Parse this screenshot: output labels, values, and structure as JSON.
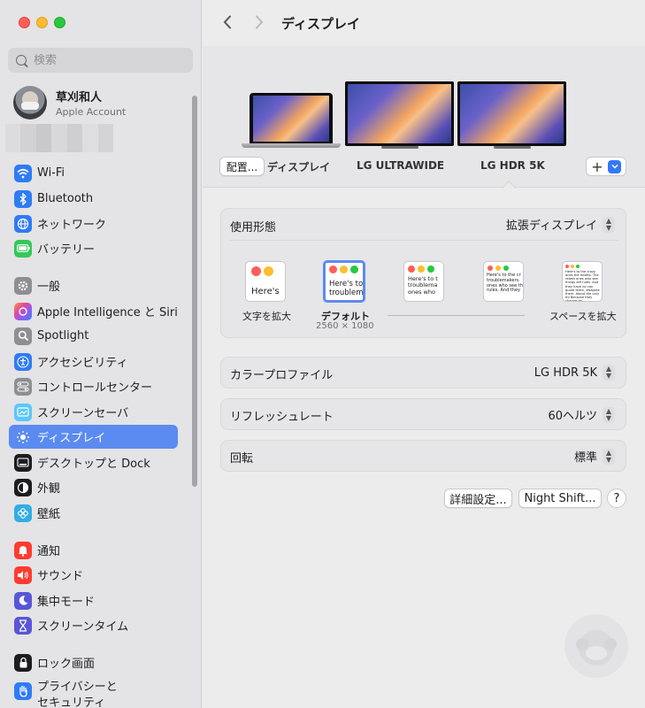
{
  "window": {
    "title": "ディスプレイ"
  },
  "search": {
    "placeholder": "検索"
  },
  "account": {
    "name": "草刈和人",
    "subtitle": "Apple Account"
  },
  "sidebar": {
    "items": [
      {
        "label": "Wi-Fi",
        "icon": "wifi-icon",
        "color": "#2f7bf5"
      },
      {
        "label": "Bluetooth",
        "icon": "bluetooth-icon",
        "color": "#2f7bf5"
      },
      {
        "label": "ネットワーク",
        "icon": "globe-icon",
        "color": "#2f7bf5"
      },
      {
        "label": "バッテリー",
        "icon": "battery-icon",
        "color": "#34c759"
      },
      {
        "label": "一般",
        "icon": "gear-icon",
        "color": "#8e8e93"
      },
      {
        "label": "Apple Intelligence と Siri",
        "icon": "siri-icon",
        "color": "#d65cf2"
      },
      {
        "label": "Spotlight",
        "icon": "magnifier-icon",
        "color": "#8e8e93"
      },
      {
        "label": "アクセシビリティ",
        "icon": "accessibility-icon",
        "color": "#2f7bf5"
      },
      {
        "label": "コントロールセンター",
        "icon": "toggles-icon",
        "color": "#8e8e93"
      },
      {
        "label": "スクリーンセーバ",
        "icon": "screensaver-icon",
        "color": "#5ac8fa"
      },
      {
        "label": "ディスプレイ",
        "icon": "sun-icon",
        "color": "#2f7bf5",
        "active": true
      },
      {
        "label": "デスクトップと Dock",
        "icon": "dock-icon",
        "color": "#1d1d1f"
      },
      {
        "label": "外観",
        "icon": "appearance-icon",
        "color": "#1d1d1f"
      },
      {
        "label": "壁紙",
        "icon": "wallpaper-icon",
        "color": "#32ade6"
      },
      {
        "label": "通知",
        "icon": "bell-icon",
        "color": "#ff3b30"
      },
      {
        "label": "サウンド",
        "icon": "speaker-icon",
        "color": "#ff3b30"
      },
      {
        "label": "集中モード",
        "icon": "moon-icon",
        "color": "#5856d6"
      },
      {
        "label": "スクリーンタイム",
        "icon": "hourglass-icon",
        "color": "#5856d6"
      },
      {
        "label": "ロック画面",
        "icon": "lock-icon",
        "color": "#1d1d1f"
      },
      {
        "label": "プライバシーと",
        "label2": "セキュリティ",
        "icon": "hand-icon",
        "color": "#2f7bf5"
      }
    ]
  },
  "arrange": {
    "arrange_button": "配置...",
    "displays": [
      {
        "label": "ディスプレイ"
      },
      {
        "label": "LG ULTRAWIDE"
      },
      {
        "label": "LG HDR 5K",
        "selected": true
      }
    ],
    "add_label": "+"
  },
  "usage": {
    "label": "使用形態",
    "value": "拡張ディスプレイ"
  },
  "resolution": {
    "options": [
      {
        "caption": "文字を拡大",
        "sample": "Here's"
      },
      {
        "caption": "デフォルト",
        "subcaption": "2560 × 1080",
        "sample": "Here's to troublem",
        "selected": true
      },
      {
        "caption": "",
        "sample": "Here's to t troublema ones who"
      },
      {
        "caption": "",
        "sample": "Here's to the cr troublemakers. ones who see th rules. And they"
      },
      {
        "caption": "スペースを拡大",
        "sample": "Here's to the crazy ones the misfits. The rebels ones who see things diff rules. And they have no can quote them, disagree them. About the only thi Because they change thi"
      }
    ]
  },
  "color_profile": {
    "label": "カラープロファイル",
    "value": "LG HDR 5K"
  },
  "refresh_rate": {
    "label": "リフレッシュレート",
    "value": "60ヘルツ"
  },
  "rotation": {
    "label": "回転",
    "value": "標準"
  },
  "buttons": {
    "advanced": "詳細設定...",
    "night_shift": "Night Shift...",
    "help": "?"
  },
  "colors": {
    "accent": "#3478f6",
    "sidebar_active": "#5b8bf0"
  }
}
